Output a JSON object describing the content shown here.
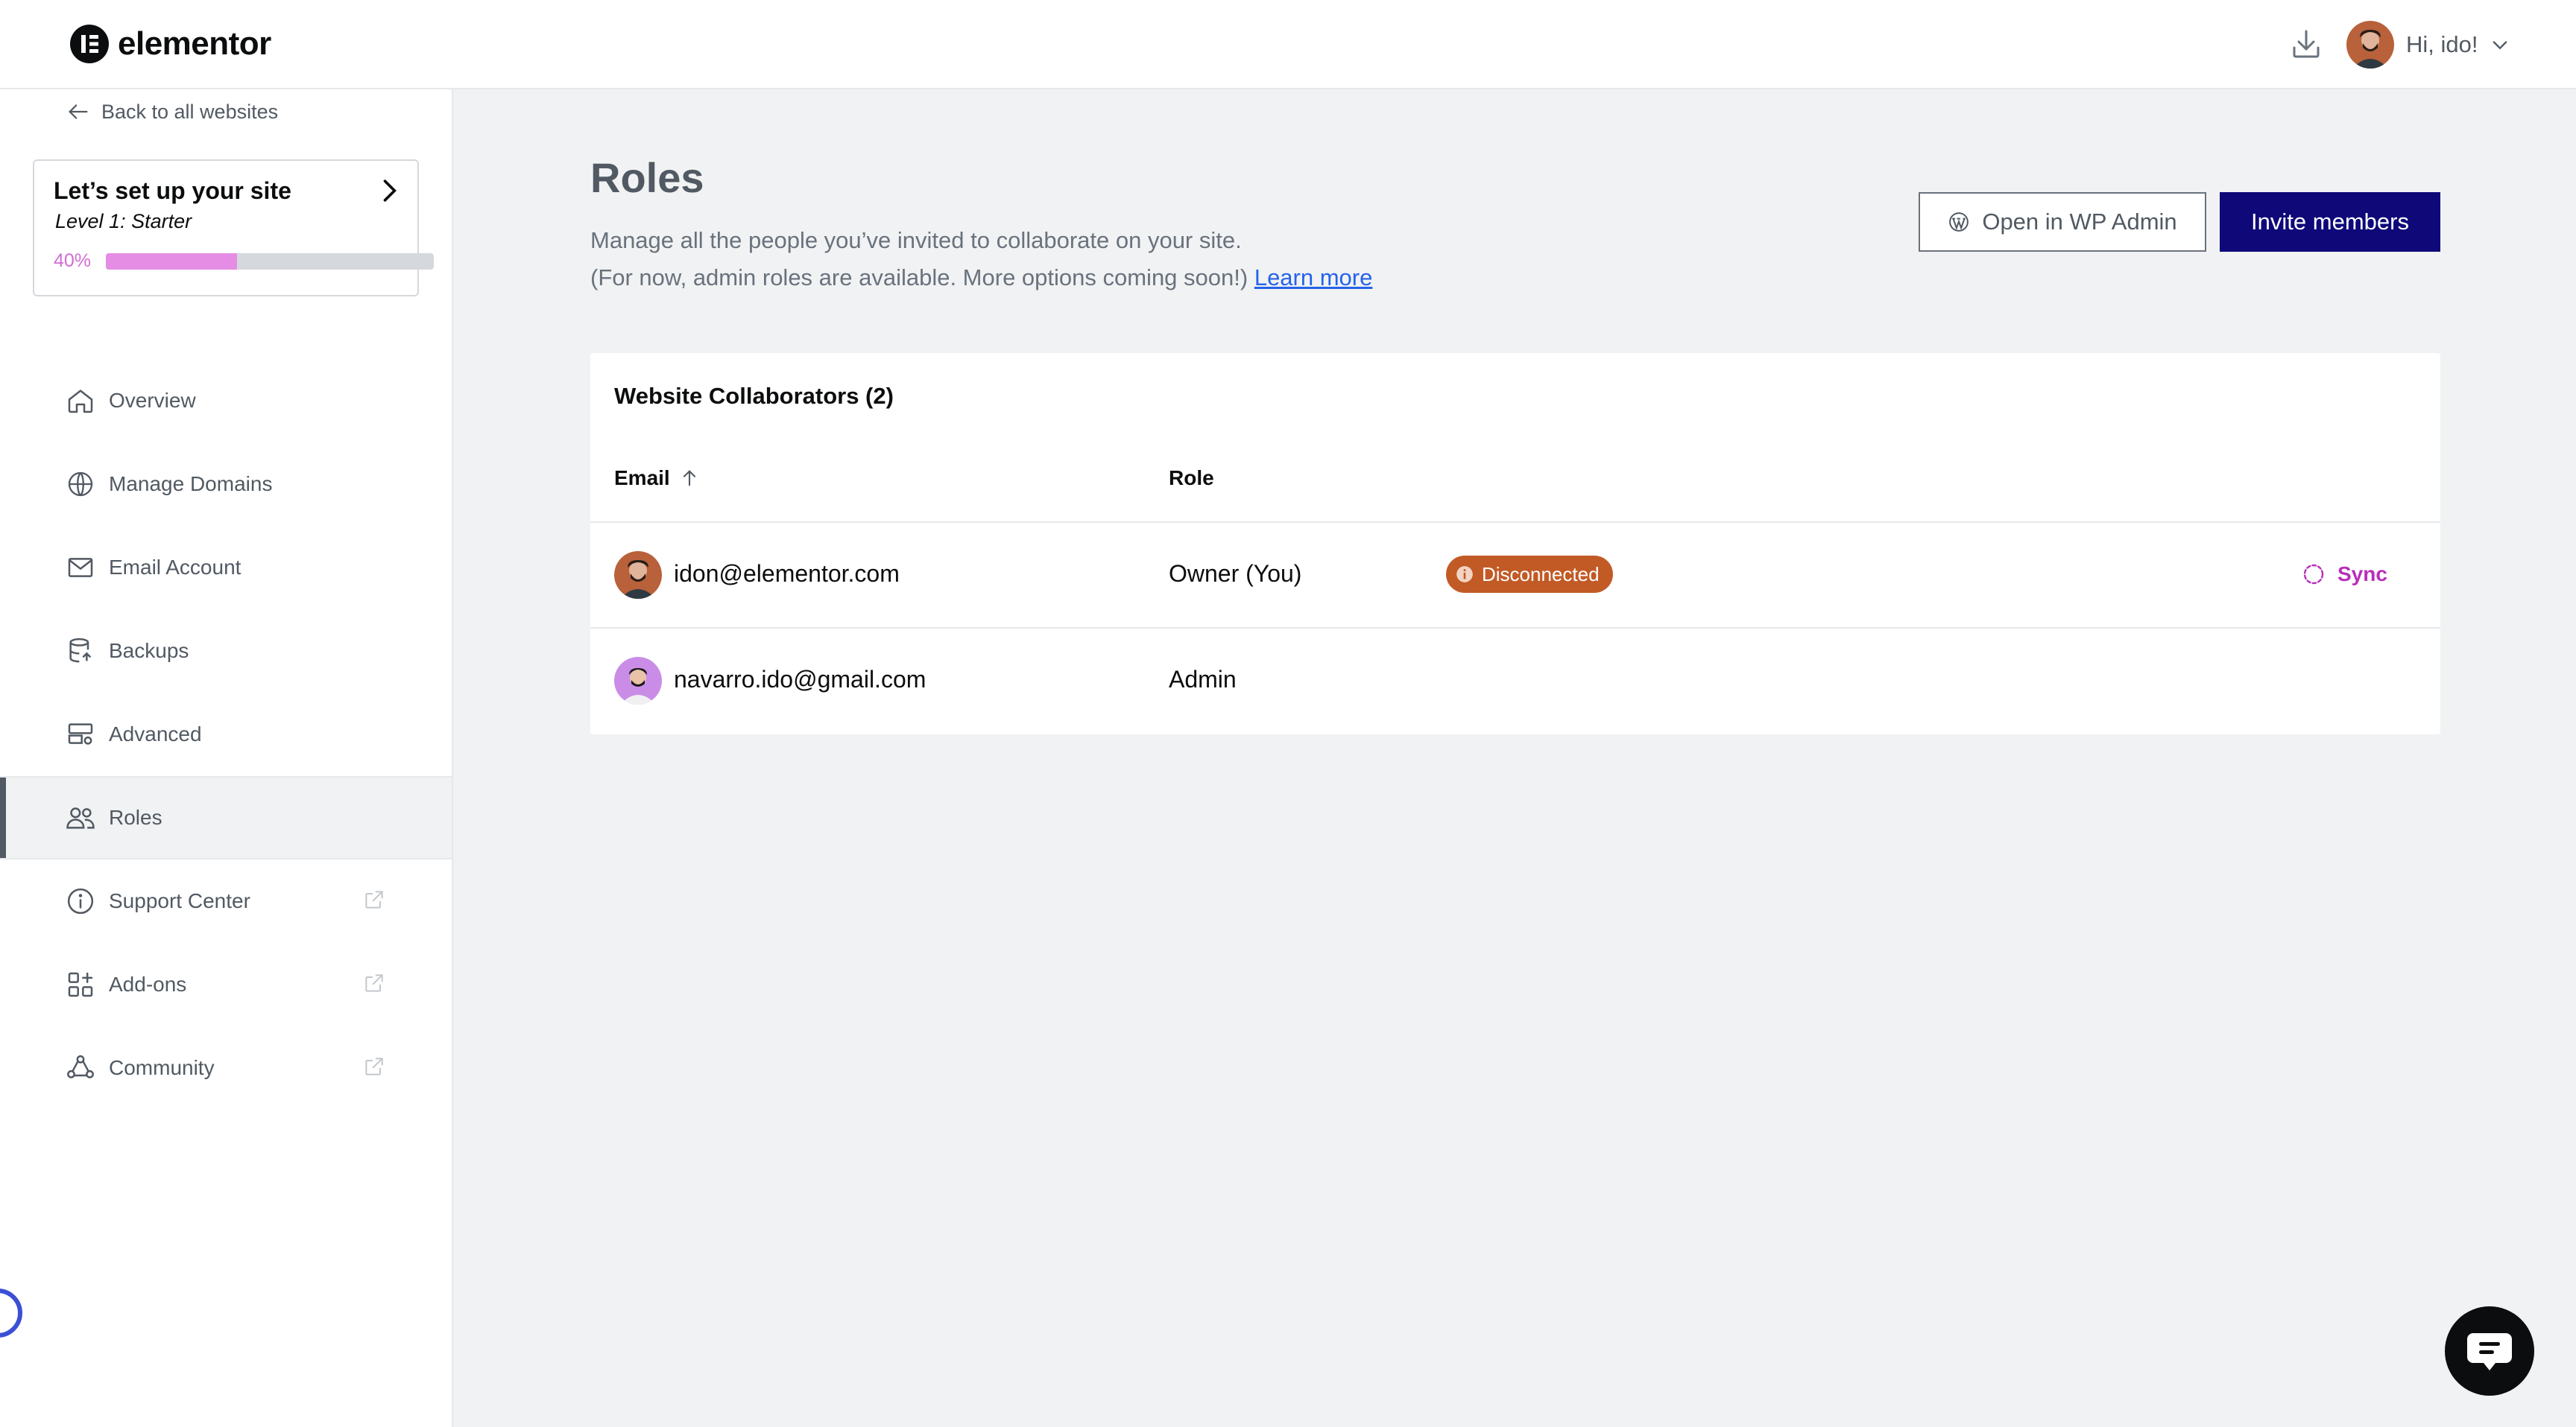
{
  "header": {
    "logo_text": "elementor",
    "greeting": "Hi, ido!"
  },
  "sidebar": {
    "back_label": "Back to all websites",
    "setup": {
      "title": "Let’s set up your site",
      "level": "Level 1: Starter",
      "progress_label": "40%",
      "progress": 0.4
    },
    "items": [
      {
        "label": "Overview",
        "icon": "home-icon"
      },
      {
        "label": "Manage Domains",
        "icon": "globe-www-icon"
      },
      {
        "label": "Email Account",
        "icon": "mail-icon"
      },
      {
        "label": "Backups",
        "icon": "database-icon"
      },
      {
        "label": "Advanced",
        "icon": "server-settings-icon"
      },
      {
        "label": "Roles",
        "icon": "users-icon",
        "active": true
      },
      {
        "label": "Support Center",
        "icon": "info-icon",
        "external": true
      },
      {
        "label": "Add-ons",
        "icon": "grid-plus-icon",
        "external": true
      },
      {
        "label": "Community",
        "icon": "community-icon",
        "external": true
      }
    ]
  },
  "main": {
    "title": "Roles",
    "desc_line1": "Manage all the people you’ve invited to collaborate on your site.",
    "desc_line2": "(For now, admin roles are available. More options coming soon!)",
    "learn_more": "Learn more",
    "btn_wp_admin": "Open in WP Admin",
    "btn_invite": "Invite members",
    "table": {
      "title": "Website Collaborators (2)",
      "col_email": "Email",
      "col_role": "Role",
      "rows": [
        {
          "email": "idon@elementor.com",
          "role": "Owner (You)",
          "badge": "Disconnected",
          "action": "Sync"
        },
        {
          "email": "navarro.ido@gmail.com",
          "role": "Admin"
        }
      ]
    }
  },
  "colors": {
    "accent": "#0e0879",
    "badge": "#c25a26",
    "sync": "#b92eb9",
    "progress": "#e58de5"
  }
}
